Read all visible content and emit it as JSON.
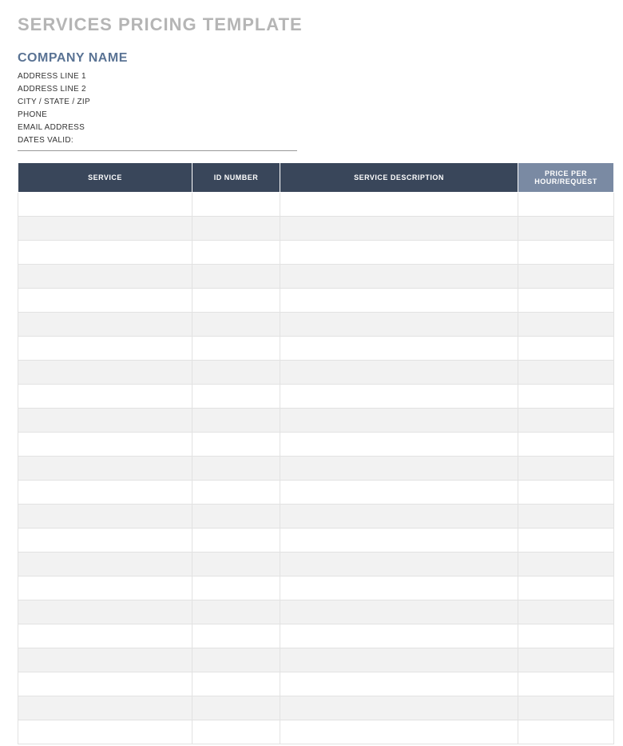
{
  "title": "SERVICES PRICING TEMPLATE",
  "company": {
    "name": "COMPANY NAME",
    "address1": "ADDRESS LINE 1",
    "address2": "ADDRESS LINE 2",
    "city_state_zip": "CITY / STATE / ZIP",
    "phone": "PHONE",
    "email": "EMAIL ADDRESS",
    "dates_valid": "DATES VALID:"
  },
  "table": {
    "headers": {
      "service": "SERVICE",
      "id_number": "ID NUMBER",
      "description": "SERVICE DESCRIPTION",
      "price": "PRICE PER HOUR/REQUEST"
    },
    "rows": [
      {
        "service": "",
        "id_number": "",
        "description": "",
        "price": ""
      },
      {
        "service": "",
        "id_number": "",
        "description": "",
        "price": ""
      },
      {
        "service": "",
        "id_number": "",
        "description": "",
        "price": ""
      },
      {
        "service": "",
        "id_number": "",
        "description": "",
        "price": ""
      },
      {
        "service": "",
        "id_number": "",
        "description": "",
        "price": ""
      },
      {
        "service": "",
        "id_number": "",
        "description": "",
        "price": ""
      },
      {
        "service": "",
        "id_number": "",
        "description": "",
        "price": ""
      },
      {
        "service": "",
        "id_number": "",
        "description": "",
        "price": ""
      },
      {
        "service": "",
        "id_number": "",
        "description": "",
        "price": ""
      },
      {
        "service": "",
        "id_number": "",
        "description": "",
        "price": ""
      },
      {
        "service": "",
        "id_number": "",
        "description": "",
        "price": ""
      },
      {
        "service": "",
        "id_number": "",
        "description": "",
        "price": ""
      },
      {
        "service": "",
        "id_number": "",
        "description": "",
        "price": ""
      },
      {
        "service": "",
        "id_number": "",
        "description": "",
        "price": ""
      },
      {
        "service": "",
        "id_number": "",
        "description": "",
        "price": ""
      },
      {
        "service": "",
        "id_number": "",
        "description": "",
        "price": ""
      },
      {
        "service": "",
        "id_number": "",
        "description": "",
        "price": ""
      },
      {
        "service": "",
        "id_number": "",
        "description": "",
        "price": ""
      },
      {
        "service": "",
        "id_number": "",
        "description": "",
        "price": ""
      },
      {
        "service": "",
        "id_number": "",
        "description": "",
        "price": ""
      },
      {
        "service": "",
        "id_number": "",
        "description": "",
        "price": ""
      },
      {
        "service": "",
        "id_number": "",
        "description": "",
        "price": ""
      },
      {
        "service": "",
        "id_number": "",
        "description": "",
        "price": ""
      }
    ]
  }
}
